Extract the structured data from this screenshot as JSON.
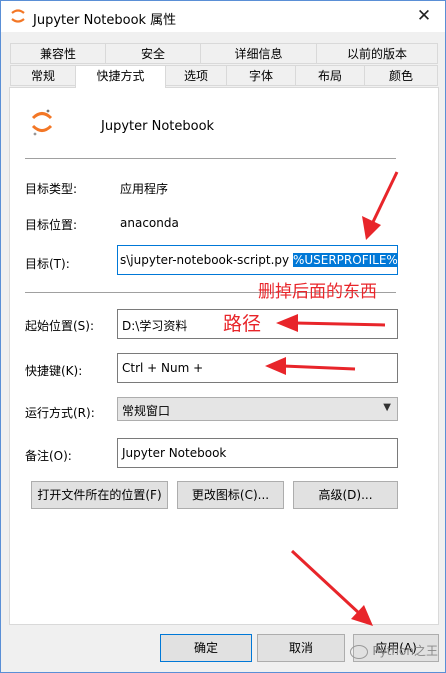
{
  "window": {
    "title": "Jupyter Notebook 属性",
    "close_glyph": "✕"
  },
  "tabs_row1": [
    "兼容性",
    "安全",
    "详细信息",
    "以前的版本"
  ],
  "tabs_row2": [
    "常规",
    "快捷方式",
    "选项",
    "字体",
    "布局",
    "颜色"
  ],
  "header": {
    "app_name": "Jupyter Notebook"
  },
  "fields": {
    "target_type_label": "目标类型:",
    "target_type_value": "应用程序",
    "target_location_label": "目标位置:",
    "target_location_value": "anaconda",
    "target_label": "目标(T):",
    "target_value_plain": "s\\jupyter-notebook-script.py ",
    "target_value_selected": "%USERPROFILE%",
    "start_in_label": "起始位置(S):",
    "start_in_value": "D:\\学习资料",
    "hotkey_label": "快捷键(K):",
    "hotkey_value": "Ctrl + Num +",
    "run_label": "运行方式(R):",
    "run_value": "常规窗口",
    "comment_label": "备注(O):",
    "comment_value": "Jupyter Notebook"
  },
  "buttons": {
    "open_location": "打开文件所在的位置(F)",
    "change_icon": "更改图标(C)...",
    "advanced": "高级(D)...",
    "ok": "确定",
    "cancel": "取消",
    "apply": "应用(A)"
  },
  "annotations": {
    "delete_note": "删掉后面的东西",
    "path_note": "路径"
  },
  "watermark": "Python之王",
  "colors": {
    "annotation": "#e8252a",
    "accent": "#0078d7"
  }
}
